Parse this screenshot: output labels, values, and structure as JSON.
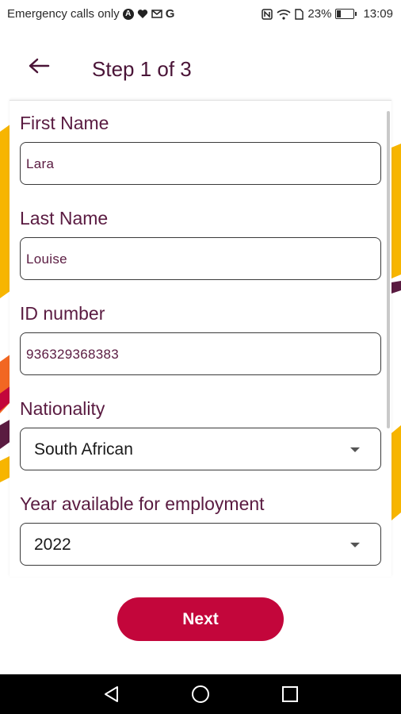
{
  "status_bar": {
    "carrier_text": "Emergency calls only",
    "battery_percent": "23%",
    "battery_level": 0.23,
    "time": "13:09",
    "icons": [
      "a-badge-icon",
      "heart-icon",
      "gmail-icon",
      "google-icon",
      "nfc-icon",
      "wifi-icon",
      "sim-icon",
      "battery-icon"
    ]
  },
  "header": {
    "title": "Step 1 of 3",
    "back_icon": "arrow-left-icon"
  },
  "form": {
    "first_name": {
      "label": "First Name",
      "value": "Lara"
    },
    "last_name": {
      "label": "Last Name",
      "value": "Louise"
    },
    "id_number": {
      "label": "ID number",
      "value": "936329368383"
    },
    "nationality": {
      "label": "Nationality",
      "selected": "South African"
    },
    "year": {
      "label": "Year available for employment",
      "selected": "2022"
    }
  },
  "next_button": {
    "label": "Next"
  },
  "colors": {
    "label": "#5a1b41",
    "title": "#4a1437",
    "button": "#c3063b",
    "deco_yellow": "#f7b500",
    "deco_red": "#c3063b",
    "deco_plum": "#5a1b41",
    "deco_orange": "#f26722"
  },
  "nav_bar": {
    "icons": [
      "back-triangle-icon",
      "home-circle-icon",
      "recents-square-icon"
    ]
  }
}
